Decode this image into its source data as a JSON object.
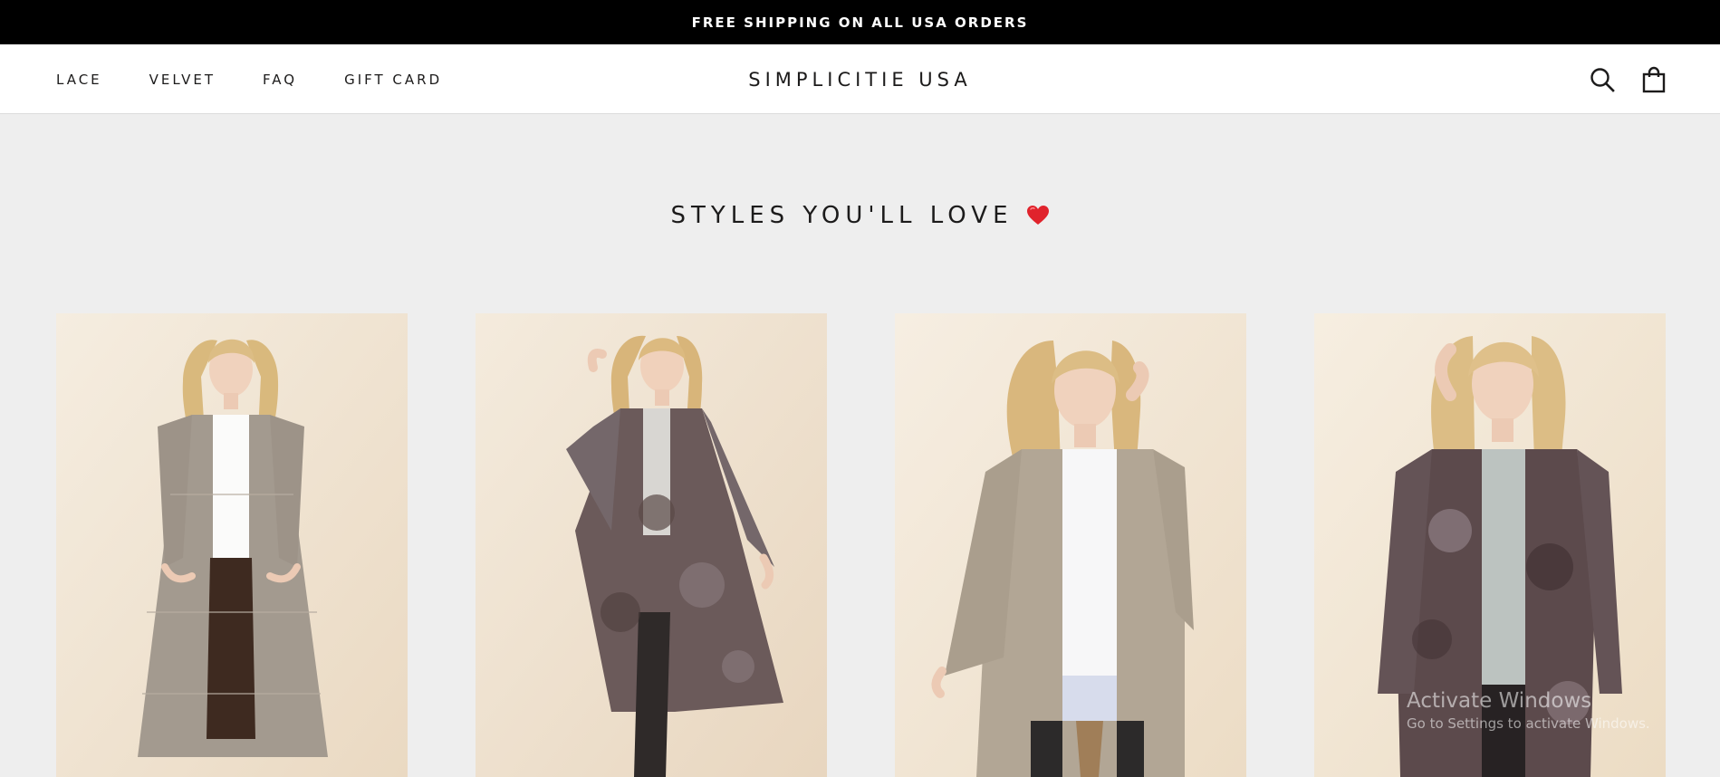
{
  "announcement": {
    "text": "FREE SHIPPING ON ALL USA ORDERS"
  },
  "header": {
    "nav": [
      {
        "label": "LACE"
      },
      {
        "label": "VELVET"
      },
      {
        "label": "FAQ"
      },
      {
        "label": "GIFT CARD"
      }
    ],
    "logo": "SIMPLICITIE USA",
    "icons": {
      "search": "search-icon",
      "cart": "shopping-bag-icon"
    }
  },
  "section": {
    "title": "STYLES YOU'LL LOVE",
    "title_icon": "heart-icon",
    "heart_color": "#e0232c"
  },
  "products": [
    {
      "image": "model in long taupe lace duster cardigan over white top"
    },
    {
      "image": "model in mauve and gray floral burnout velvet duster"
    },
    {
      "image": "model in champagne lace duster cardigan, close-up"
    },
    {
      "image": "model in dark mauve floral velvet duster, close-up"
    }
  ],
  "watermark": {
    "title": "Activate Windows",
    "subtitle": "Go to Settings to activate Windows."
  },
  "colors": {
    "announcement_bg": "#000000",
    "page_bg": "#eeeeee",
    "header_bg": "#ffffff",
    "text": "#1c1b1b",
    "photo_backdrop": "#f2e8d8"
  }
}
